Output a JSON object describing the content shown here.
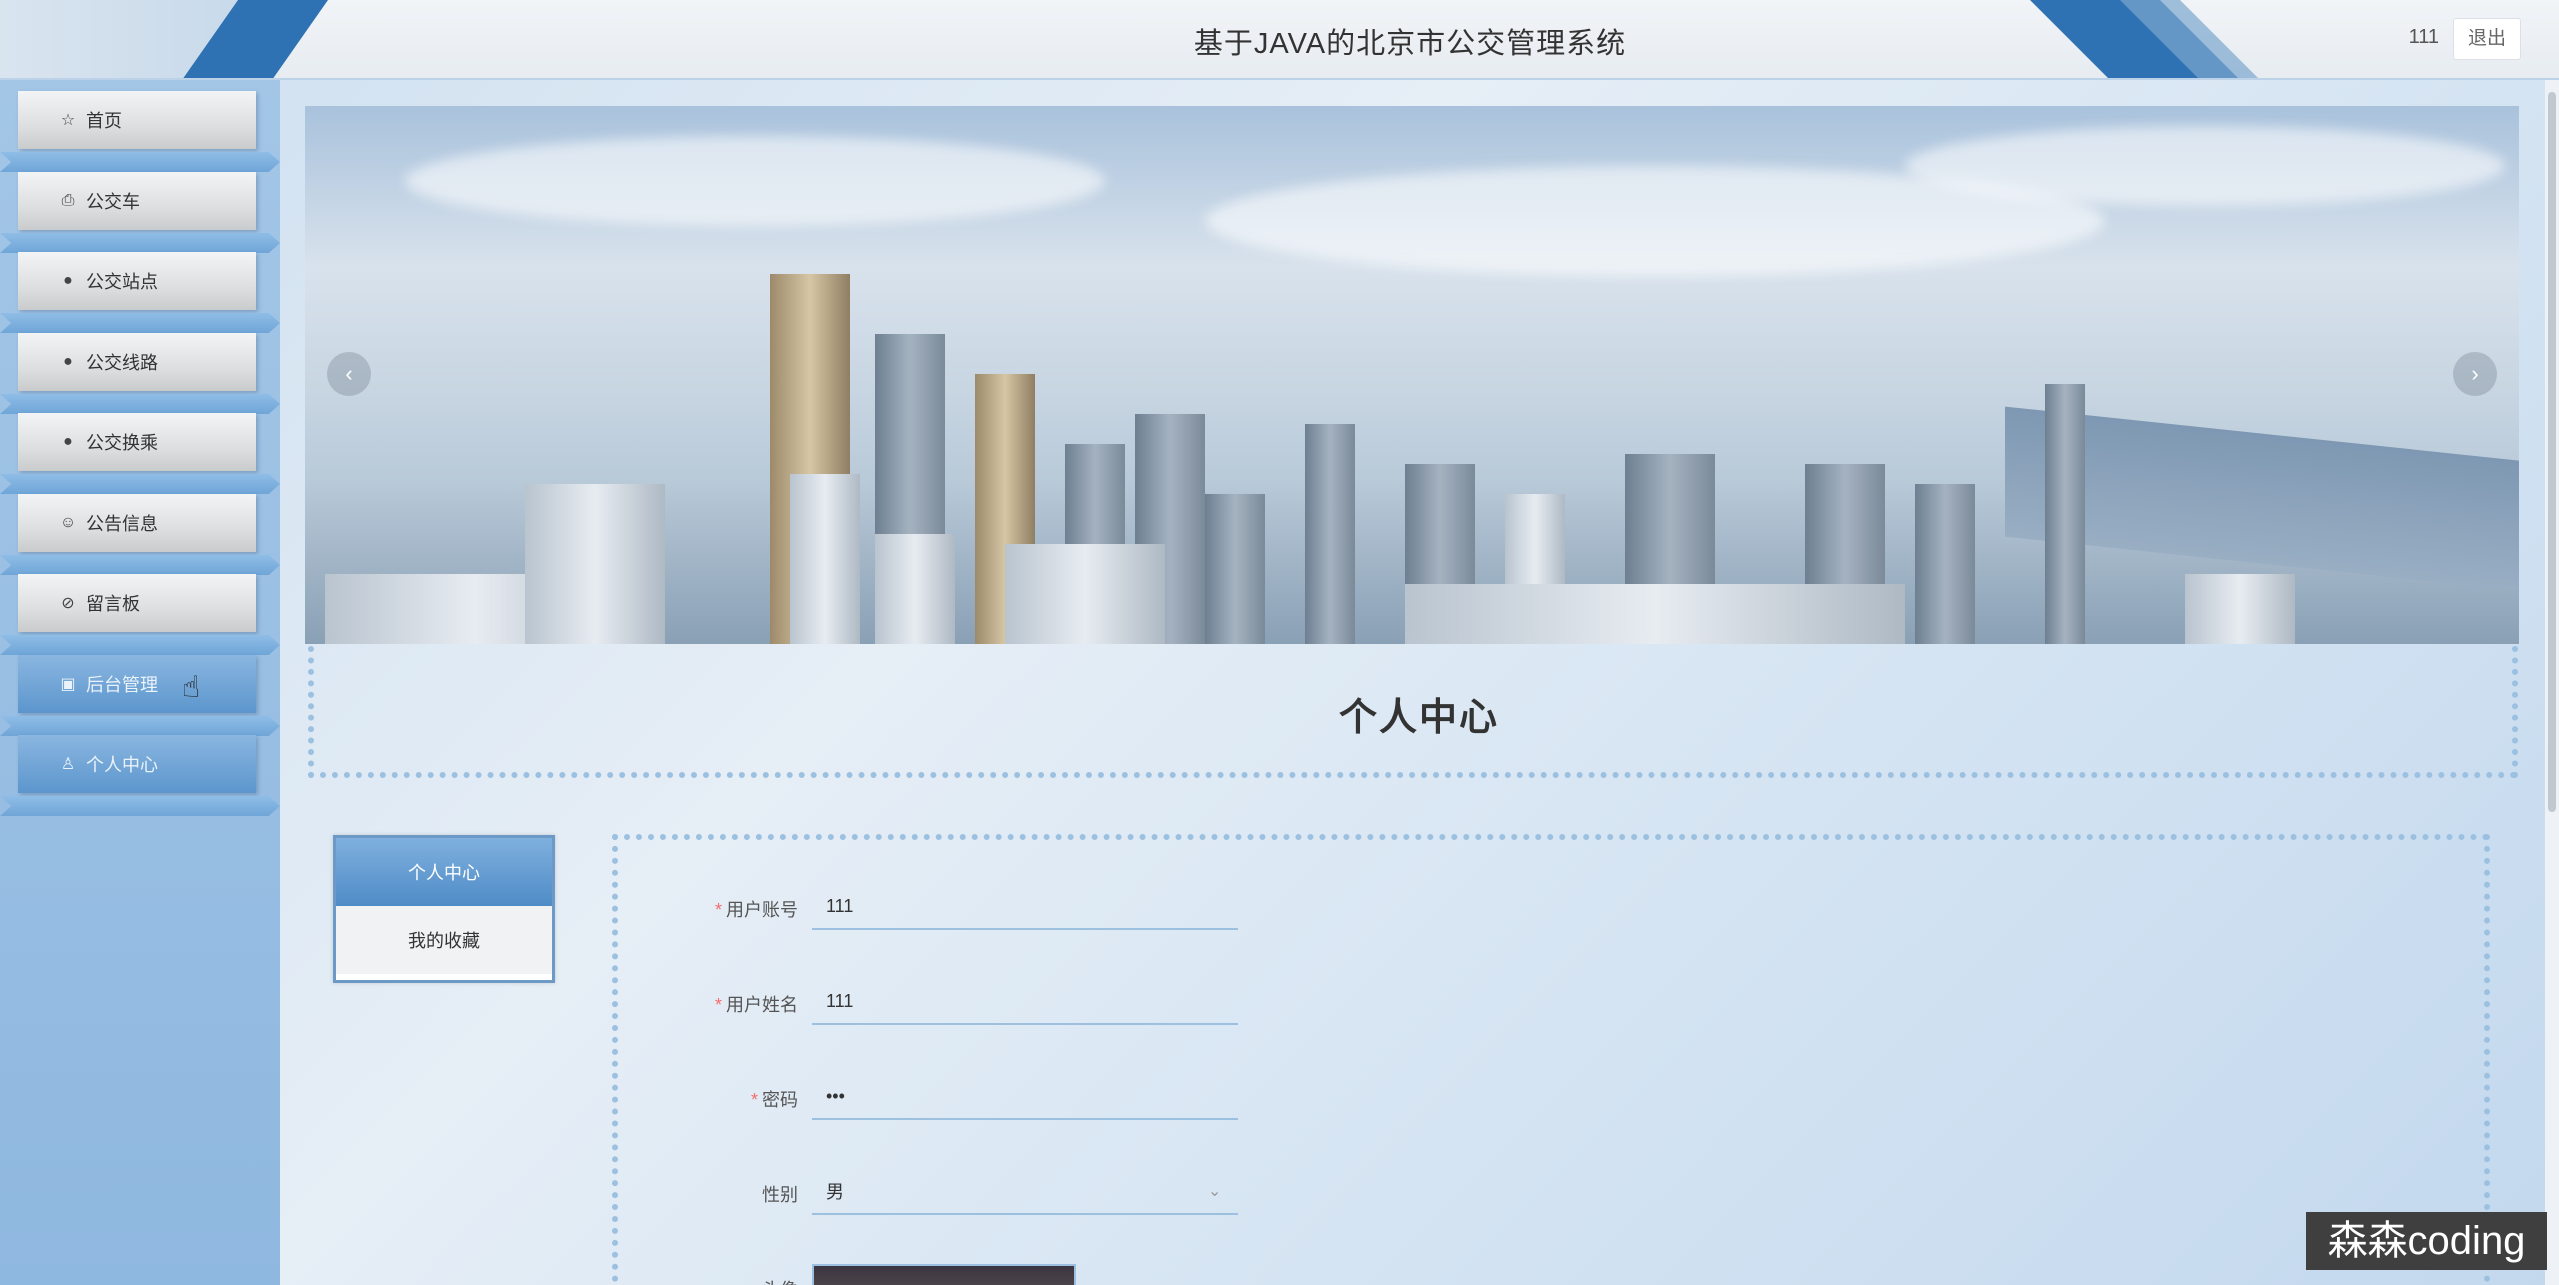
{
  "header": {
    "title": "基于JAVA的北京市公交管理系统",
    "username": "111",
    "logout_label": "退出"
  },
  "sidebar": {
    "items": [
      {
        "label": "首页",
        "icon": "star-icon"
      },
      {
        "label": "公交车",
        "icon": "bag-icon"
      },
      {
        "label": "公交站点",
        "icon": "info-icon"
      },
      {
        "label": "公交线路",
        "icon": "question-icon"
      },
      {
        "label": "公交换乘",
        "icon": "info-icon"
      },
      {
        "label": "公告信息",
        "icon": "smile-icon"
      },
      {
        "label": "留言板",
        "icon": "check-circle-icon"
      },
      {
        "label": "后台管理",
        "icon": "briefcase-icon"
      },
      {
        "label": "个人中心",
        "icon": "user-icon"
      }
    ],
    "active_index": 8
  },
  "banner": {
    "prev_glyph": "‹",
    "next_glyph": "›"
  },
  "section": {
    "title": "个人中心"
  },
  "subnav": {
    "items": [
      {
        "label": "个人中心"
      },
      {
        "label": "我的收藏"
      }
    ]
  },
  "form": {
    "fields": [
      {
        "label": "用户账号",
        "required": true,
        "value": "111"
      },
      {
        "label": "用户姓名",
        "required": true,
        "value": "111"
      },
      {
        "label": "密码",
        "required": true,
        "value": "•••"
      },
      {
        "label": "性别",
        "required": false,
        "value": "男"
      },
      {
        "label": "头像",
        "required": false,
        "value": ""
      }
    ]
  },
  "watermark": {
    "text": "森森coding"
  },
  "colors": {
    "accent": "#2f72b3",
    "menu_active": "#5c96cd",
    "required": "#f56c6c",
    "border_dotted": "#9cc0e0"
  }
}
